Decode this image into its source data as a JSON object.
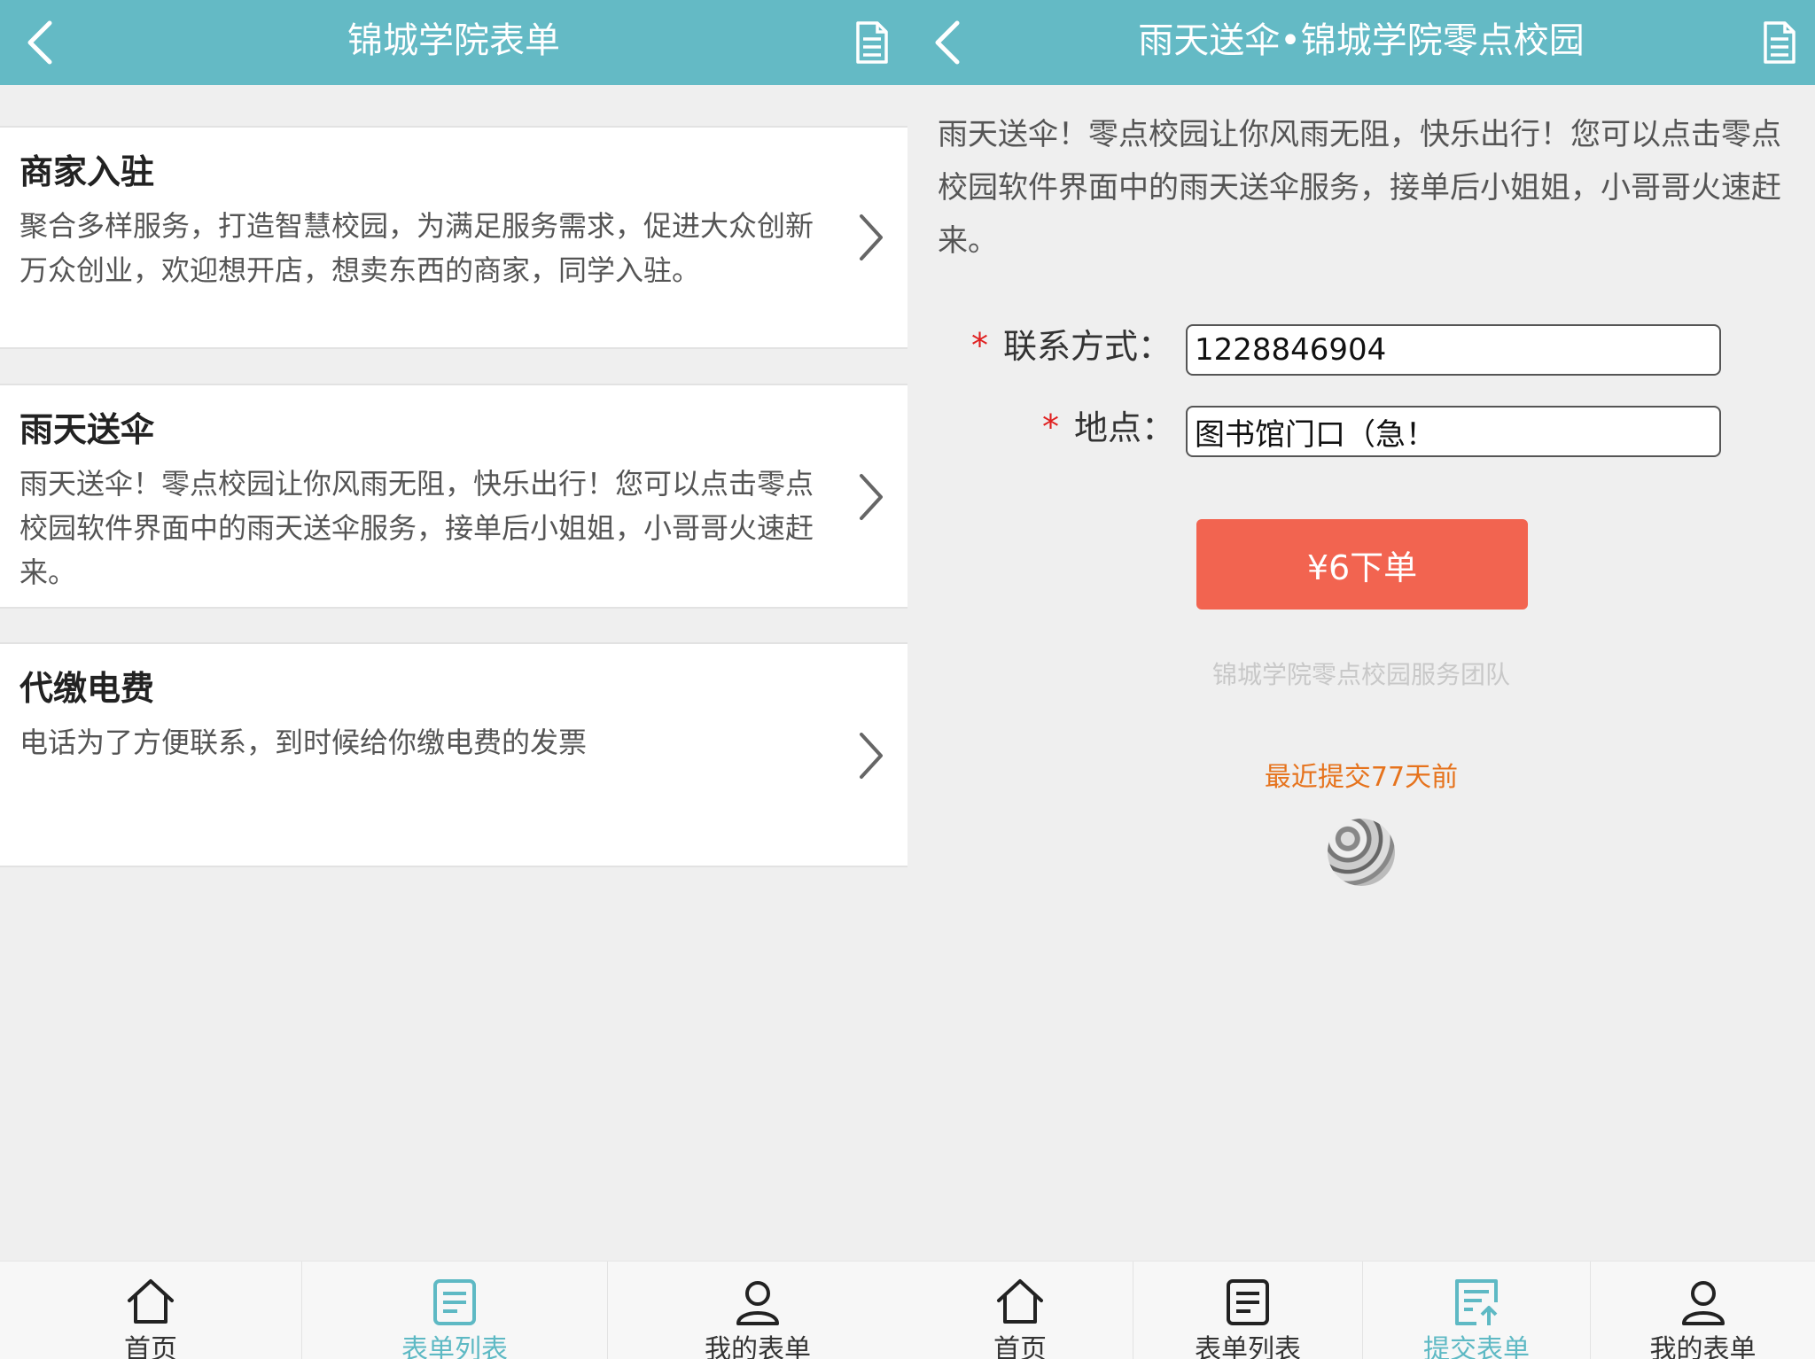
{
  "left": {
    "title": "锦城学院表单",
    "items": [
      {
        "title": "商家入驻",
        "desc": "聚合多样服务，打造智慧校园，为满足服务需求，促进大众创新万众创业，欢迎想开店，想卖东西的商家，同学入驻。"
      },
      {
        "title": "雨天送伞",
        "desc": "雨天送伞！零点校园让你风雨无阻，快乐出行！您可以点击零点校园软件界面中的雨天送伞服务，接单后小姐姐，小哥哥火速赶来。"
      },
      {
        "title": "代缴电费",
        "desc": "电话为了方便联系，到时候给你缴电费的发票"
      }
    ],
    "tabs": [
      {
        "label": "首页",
        "icon": "home-icon"
      },
      {
        "label": "表单列表",
        "icon": "list-icon",
        "active": true
      },
      {
        "label": "我的表单",
        "icon": "user-icon"
      }
    ]
  },
  "right": {
    "title": "雨天送伞•锦城学院零点校园",
    "intro": "雨天送伞！零点校园让你风雨无阻，快乐出行！您可以点击零点校园软件界面中的雨天送伞服务，接单后小姐姐，小哥哥火速赶来。",
    "form": {
      "contact_label": "联系方式：",
      "contact_value": "1228846904",
      "location_label": "地点：",
      "location_value": "图书馆门口（急！",
      "required_mark": "*"
    },
    "submit_label": "¥6下单",
    "team": "锦城学院零点校园服务团队",
    "recent": "最近提交77天前",
    "tabs": [
      {
        "label": "首页",
        "icon": "home-icon"
      },
      {
        "label": "表单列表",
        "icon": "list-icon"
      },
      {
        "label": "提交表单",
        "icon": "submit-form-icon",
        "active": true
      },
      {
        "label": "我的表单",
        "icon": "user-icon"
      }
    ]
  },
  "colors": {
    "header": "#64bac5",
    "accent": "#5eb9c4",
    "submit": "#f26450",
    "recent": "#e6731d",
    "required": "#e02020"
  }
}
